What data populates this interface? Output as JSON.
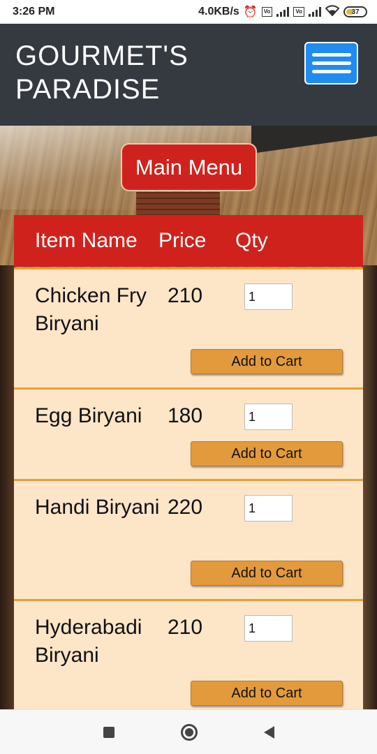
{
  "status_bar": {
    "time": "3:26 PM",
    "network_speed": "4.0KB/s",
    "battery_level": "37",
    "icons": [
      "alarm-off-icon",
      "volte-icon",
      "signal-icon",
      "volte-icon",
      "signal-icon",
      "wifi-icon",
      "battery-icon"
    ]
  },
  "header": {
    "brand_line1": "GOURMET'S",
    "brand_line2": "PARADISE",
    "menu_icon": "hamburger-menu-icon"
  },
  "main_menu_label": "Main Menu",
  "table": {
    "columns": [
      "Item Name",
      "Price",
      "Qty"
    ],
    "items": [
      {
        "name": "Chicken Fry Biryani",
        "price": "210",
        "qty": "1",
        "button": "Add to Cart"
      },
      {
        "name": "Egg Biryani",
        "price": "180",
        "qty": "1",
        "button": "Add to Cart"
      },
      {
        "name": "Handi Biryani",
        "price": "220",
        "qty": "1",
        "button": "Add to Cart"
      },
      {
        "name": "Hyderabadi Biryani",
        "price": "210",
        "qty": "1",
        "button": "Add to Cart"
      }
    ]
  },
  "colors": {
    "header_bg": "#343a40",
    "accent_red": "#d0221d",
    "menu_button_blue": "#1e8cf0",
    "row_bg": "#fde5c8",
    "cart_button": "#e39a3c"
  },
  "nav_bar": {
    "icons": [
      "recent-apps-icon",
      "home-icon",
      "back-icon"
    ]
  }
}
